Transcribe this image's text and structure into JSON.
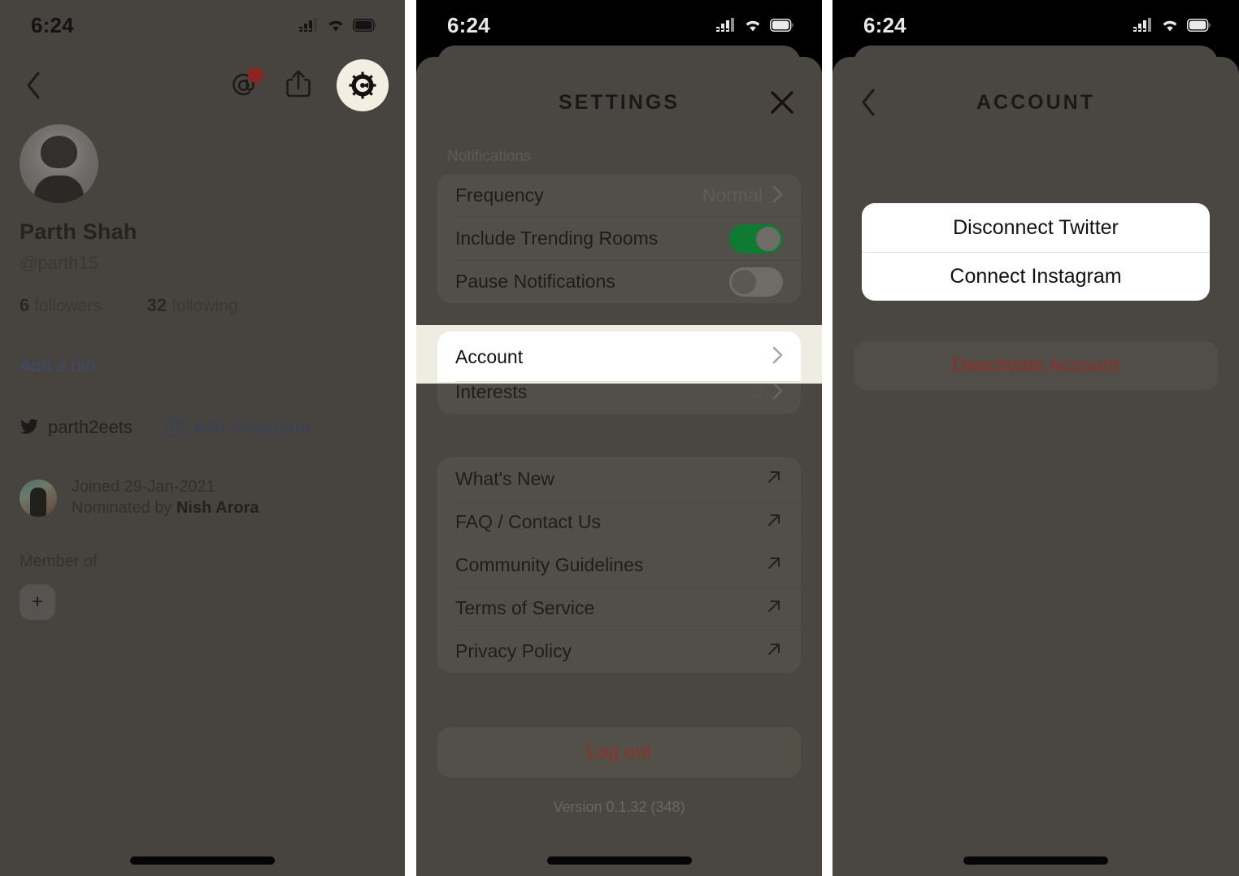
{
  "status_bar": {
    "time": "6:24",
    "icons": [
      "cellular-signal-icon",
      "wifi-icon",
      "battery-icon"
    ]
  },
  "panels": {
    "profile": {
      "name": "profile-screen",
      "topbar": {
        "back_icon": "chevron-left-icon",
        "mentions_icon": "at-sign-icon",
        "share_icon": "share-icon",
        "settings_icon": "gear-icon"
      },
      "user": {
        "display_name": "Parth Shah",
        "handle": "@parth15",
        "followers_count": "6",
        "followers_label": "followers",
        "following_count": "32",
        "following_label": "following",
        "bio_placeholder": "Add a bio"
      },
      "socials": {
        "twitter_handle": "parth2eets",
        "instagram_label": "Add Instagram"
      },
      "joined": {
        "joined_text": "Joined 29-Jan-2021",
        "nominated_prefix": "Nominated by ",
        "nominated_by": "Nish Arora"
      },
      "member_of": {
        "label": "Member of",
        "add_label": "+"
      }
    },
    "settings": {
      "name": "settings-sheet",
      "title": "SETTINGS",
      "close_icon": "close-x-icon",
      "notifications_group_label": "Notifications",
      "notification_rows": [
        {
          "label": "Frequency",
          "value": "Normal",
          "type": "disclosure"
        },
        {
          "label": "Include Trending Rooms",
          "value": "on",
          "type": "toggle"
        },
        {
          "label": "Pause Notifications",
          "value": "off",
          "type": "toggle"
        }
      ],
      "account_rows": [
        {
          "label": "Account",
          "value": "",
          "type": "disclosure",
          "highlighted": true
        },
        {
          "label": "Interests",
          "value": "6",
          "type": "disclosure",
          "highlighted": false
        }
      ],
      "link_rows": [
        {
          "label": "What's New"
        },
        {
          "label": "FAQ / Contact Us"
        },
        {
          "label": "Community Guidelines"
        },
        {
          "label": "Terms of Service"
        },
        {
          "label": "Privacy Policy"
        }
      ],
      "logout_label": "Log out",
      "version_text": "Version 0.1.32 (348)"
    },
    "account": {
      "name": "account-screen",
      "title": "ACCOUNT",
      "back_icon": "chevron-left-icon",
      "action_sheet_items": [
        {
          "label": "Disconnect Twitter"
        },
        {
          "label": "Connect Instagram"
        }
      ],
      "deactivate_label": "Deactivate Account"
    }
  },
  "colors": {
    "dim_overlay": "#474440",
    "sheet_bg": "#4a4743",
    "card_bg": "#524f4b",
    "highlight_band": "#efece1",
    "highlight_row": "#ffffff",
    "toggle_on": "#0e7a32",
    "destructive": "#8e3228",
    "link_blue": "#3f4a63",
    "accent_cream": "#f2efe2",
    "badge_red": "#8d2424"
  }
}
